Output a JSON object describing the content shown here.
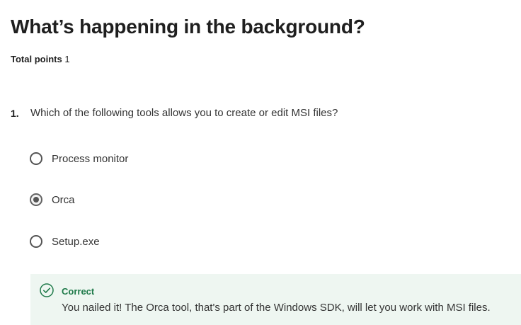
{
  "page": {
    "title": "What’s happening in the background?",
    "points_label": "Total points",
    "points_value": "1"
  },
  "question": {
    "number": "1.",
    "text": "Which of the following tools allows you to create or edit MSI files?",
    "options": [
      {
        "label": "Process monitor",
        "selected": false
      },
      {
        "label": "Orca",
        "selected": true
      },
      {
        "label": "Setup.exe",
        "selected": false
      }
    ]
  },
  "feedback": {
    "status": "Correct",
    "message": "You nailed it! The Orca tool, that's part of the Windows SDK, will let you work with MSI files.",
    "accent_color": "#1f7a4a",
    "background_color": "#eef6f1",
    "icon": "check-circle-icon"
  }
}
